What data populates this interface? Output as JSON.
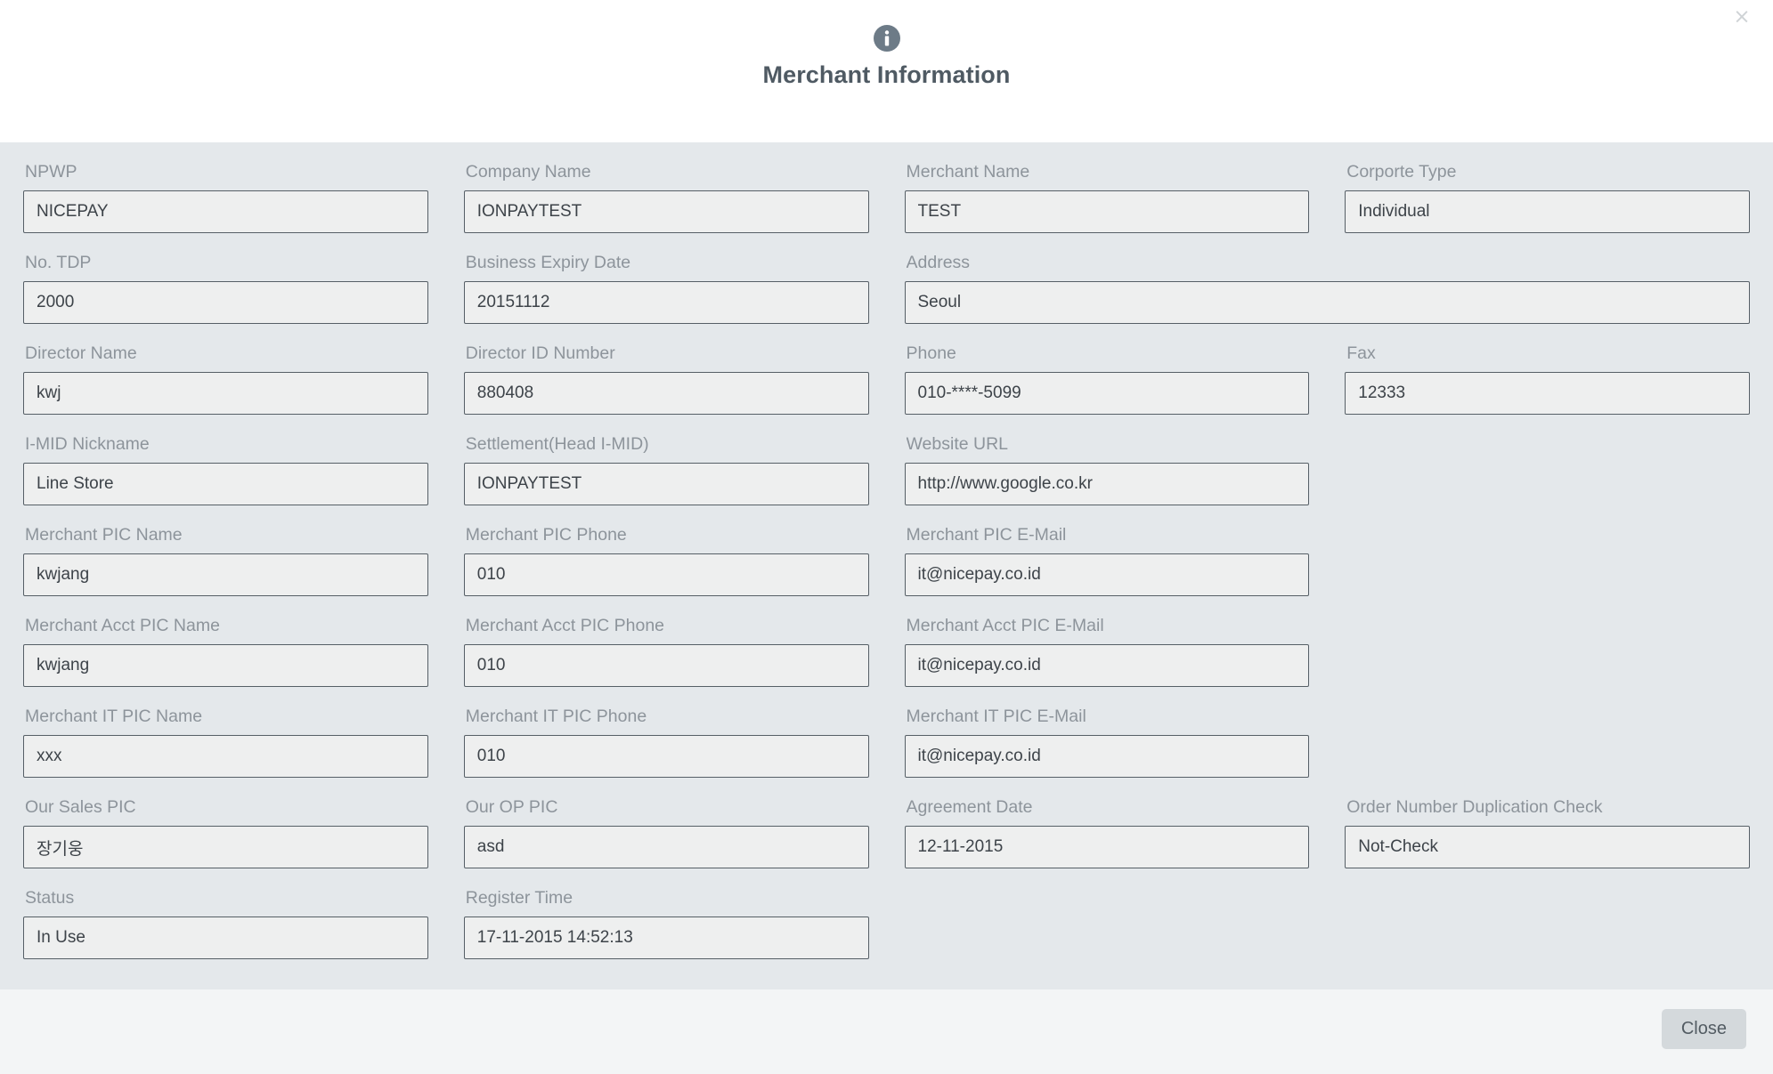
{
  "header": {
    "icon": "info-circle-icon",
    "title": "Merchant Information",
    "close_icon": "close-icon",
    "close_glyph": "×"
  },
  "colors": {
    "body_bg": "#e4e8eb",
    "footer_bg": "#f3f5f6",
    "input_bg": "#eeefef",
    "input_border": "#565f66",
    "label": "#8d949b",
    "title": "#4f5a63",
    "icon": "#6d7b87",
    "button_bg": "#d4d9dc"
  },
  "fields": [
    {
      "label": "NPWP",
      "value": "NICEPAY",
      "span": 1
    },
    {
      "label": "Company Name",
      "value": "IONPAYTEST",
      "span": 1
    },
    {
      "label": "Merchant Name",
      "value": "TEST",
      "span": 1
    },
    {
      "label": "Corporte Type",
      "value": "Individual",
      "span": 1
    },
    {
      "label": "No. TDP",
      "value": "2000",
      "span": 1
    },
    {
      "label": "Business Expiry Date",
      "value": "20151112",
      "span": 1
    },
    {
      "label": "Address",
      "value": "Seoul",
      "span": 2
    },
    {
      "label": "Director Name",
      "value": "kwj",
      "span": 1
    },
    {
      "label": "Director ID Number",
      "value": "880408",
      "span": 1
    },
    {
      "label": "Phone",
      "value": "010-****-5099",
      "span": 1
    },
    {
      "label": "Fax",
      "value": "12333",
      "span": 1
    },
    {
      "label": "I-MID Nickname",
      "value": "Line Store",
      "span": 1
    },
    {
      "label": "Settlement(Head I-MID)",
      "value": "IONPAYTEST",
      "span": 1
    },
    {
      "label": "Website URL",
      "value": "http://www.google.co.kr",
      "span": 1
    },
    {
      "label": "",
      "value": "",
      "span": 1,
      "empty": true
    },
    {
      "label": "Merchant PIC Name",
      "value": "kwjang",
      "span": 1
    },
    {
      "label": "Merchant PIC Phone",
      "value": "010",
      "span": 1
    },
    {
      "label": "Merchant PIC E-Mail",
      "value": "it@nicepay.co.id",
      "span": 1
    },
    {
      "label": "",
      "value": "",
      "span": 1,
      "empty": true
    },
    {
      "label": "Merchant Acct PIC Name",
      "value": "kwjang",
      "span": 1
    },
    {
      "label": "Merchant Acct PIC Phone",
      "value": "010",
      "span": 1
    },
    {
      "label": "Merchant Acct PIC E-Mail",
      "value": "it@nicepay.co.id",
      "span": 1
    },
    {
      "label": "",
      "value": "",
      "span": 1,
      "empty": true
    },
    {
      "label": "Merchant IT PIC Name",
      "value": "xxx",
      "span": 1
    },
    {
      "label": "Merchant IT PIC Phone",
      "value": "010",
      "span": 1
    },
    {
      "label": "Merchant IT PIC E-Mail",
      "value": "it@nicepay.co.id",
      "span": 1
    },
    {
      "label": "",
      "value": "",
      "span": 1,
      "empty": true
    },
    {
      "label": "Our Sales PIC",
      "value": "장기웅",
      "span": 1
    },
    {
      "label": "Our OP PIC",
      "value": "asd",
      "span": 1
    },
    {
      "label": "Agreement Date",
      "value": "12-11-2015",
      "span": 1
    },
    {
      "label": "Order Number Duplication Check",
      "value": "Not-Check",
      "span": 1
    },
    {
      "label": "Status",
      "value": "In Use",
      "span": 1
    },
    {
      "label": "Register Time",
      "value": "17-11-2015 14:52:13",
      "span": 1
    },
    {
      "label": "",
      "value": "",
      "span": 1,
      "empty": true
    },
    {
      "label": "",
      "value": "",
      "span": 1,
      "empty": true
    }
  ],
  "footer": {
    "close_button": "Close"
  }
}
